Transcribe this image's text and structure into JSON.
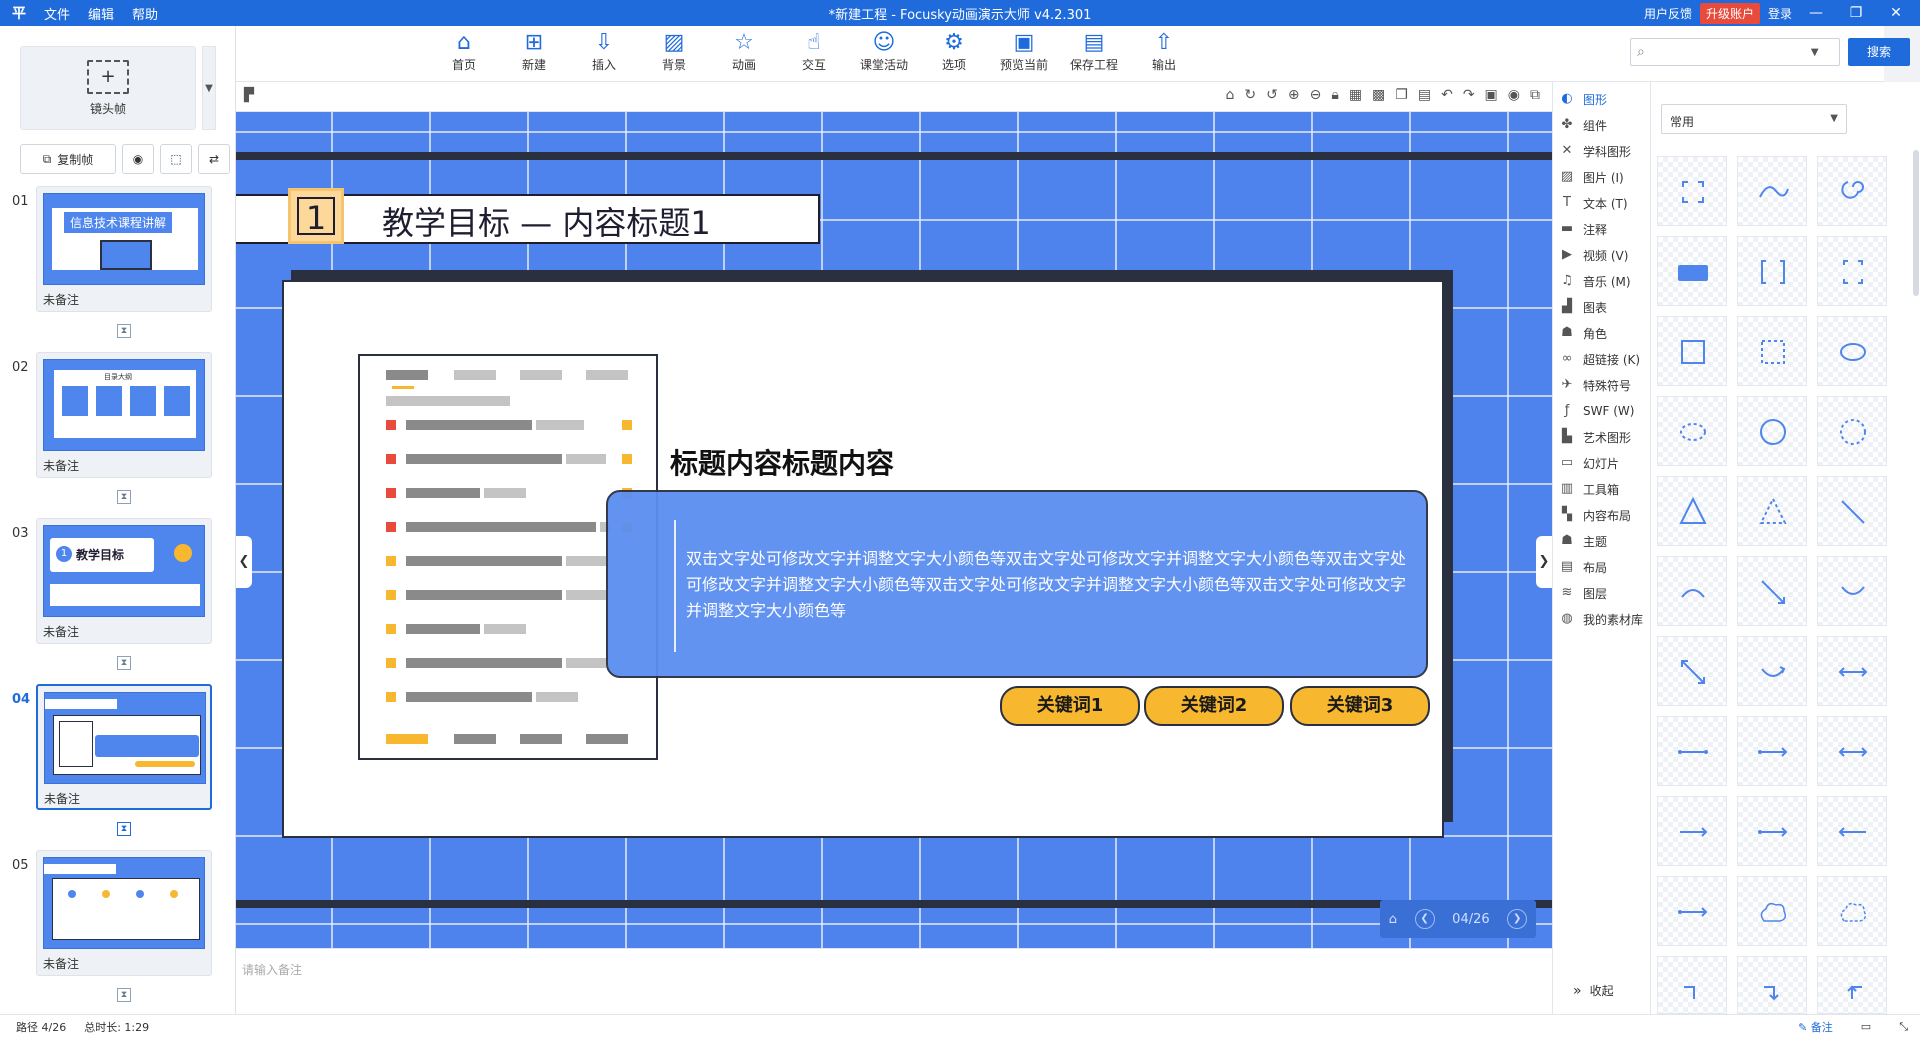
{
  "titlebar": {
    "logo": "平",
    "menu": [
      "文件",
      "编辑",
      "帮助"
    ],
    "window_title": "*新建工程 - Focusky动画演示大师  v4.2.301",
    "feedback": "用户反馈",
    "upgrade": "升级账户",
    "login": "登录",
    "min": "—",
    "max": "❐",
    "close": "✕"
  },
  "toolbar": {
    "items": [
      {
        "label": "首页",
        "icon": "home-icon"
      },
      {
        "label": "新建",
        "icon": "new-icon"
      },
      {
        "label": "插入",
        "icon": "insert-icon"
      },
      {
        "label": "背景",
        "icon": "background-icon"
      },
      {
        "label": "动画",
        "icon": "animation-icon"
      },
      {
        "label": "交互",
        "icon": "interaction-icon"
      },
      {
        "label": "课堂活动",
        "icon": "classroom-icon"
      },
      {
        "label": "选项",
        "icon": "options-icon"
      },
      {
        "label": "预览当前",
        "icon": "preview-icon"
      },
      {
        "label": "保存工程",
        "icon": "save-icon"
      },
      {
        "label": "输出",
        "icon": "export-icon"
      }
    ],
    "search_placeholder": "",
    "search_button": "搜索"
  },
  "left": {
    "camera_frame": "镜头帧",
    "copy_frame": "复制帧",
    "frames": [
      {
        "num": "01",
        "note": "未备注",
        "thumb_title": "信息技术课程讲解"
      },
      {
        "num": "02",
        "note": "未备注",
        "thumb_title": "目录大纲"
      },
      {
        "num": "03",
        "note": "未备注",
        "thumb_title": "教学目标"
      },
      {
        "num": "04",
        "note": "未备注",
        "thumb_title": ""
      },
      {
        "num": "05",
        "note": "未备注",
        "thumb_title": ""
      }
    ]
  },
  "slide": {
    "number": "1",
    "title": "教学目标 — 内容标题1",
    "subheading": "标题内容标题内容",
    "body": "双击文字处可修改文字并调整文字大小颜色等双击文字处可修改文字并调整文字大小颜色等双击文字处可修改文字并调整文字大小颜色等双击文字处可修改文字并调整文字大小颜色等双击文字处可修改文字并调整文字大小颜色等",
    "keywords": [
      "关键词1",
      "关键词2",
      "关键词3"
    ],
    "pager": "04/26"
  },
  "notes_placeholder": "请输入备注",
  "rightnav": {
    "items": [
      {
        "label": "图形",
        "icon": "shape-icon",
        "active": true
      },
      {
        "label": "组件",
        "icon": "component-icon"
      },
      {
        "label": "学科图形",
        "icon": "subject-icon"
      },
      {
        "label": "图片 (I)",
        "icon": "image-icon"
      },
      {
        "label": "文本 (T)",
        "icon": "text-icon"
      },
      {
        "label": "注释",
        "icon": "comment-icon"
      },
      {
        "label": "视频 (V)",
        "icon": "video-icon"
      },
      {
        "label": "音乐 (M)",
        "icon": "music-icon"
      },
      {
        "label": "图表",
        "icon": "chart-icon"
      },
      {
        "label": "角色",
        "icon": "role-icon"
      },
      {
        "label": "超链接 (K)",
        "icon": "link-icon"
      },
      {
        "label": "特殊符号",
        "icon": "symbol-icon"
      },
      {
        "label": "SWF (W)",
        "icon": "swf-icon"
      },
      {
        "label": "艺术图形",
        "icon": "art-icon"
      },
      {
        "label": "幻灯片",
        "icon": "slide-icon"
      },
      {
        "label": "工具箱",
        "icon": "toolbox-icon"
      },
      {
        "label": "内容布局",
        "icon": "layout-content-icon"
      },
      {
        "label": "主题",
        "icon": "theme-icon"
      },
      {
        "label": "布局",
        "icon": "layout-icon"
      },
      {
        "label": "图层",
        "icon": "layers-icon"
      },
      {
        "label": "我的素材库",
        "icon": "library-icon"
      }
    ],
    "collapse": "收起"
  },
  "shapes": {
    "category": "常用"
  },
  "status": {
    "path": "路径 4/26",
    "duration": "总时长: 1:29",
    "note_btn": "备注"
  },
  "colors": {
    "brand": "#1f6bdc",
    "canvas": "#4e82ec",
    "keyword": "#f7b72e",
    "upgrade": "#e84a3c"
  }
}
